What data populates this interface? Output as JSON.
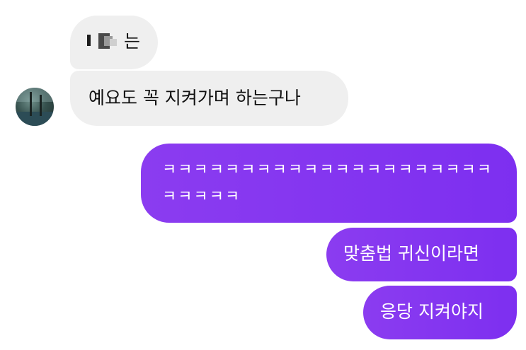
{
  "messages": {
    "incoming": [
      {
        "text": "는"
      },
      {
        "text": "예요도 꼭 지켜가며 하는구나"
      }
    ],
    "outgoing": [
      {
        "text": "ㅋㅋㅋㅋㅋㅋㅋㅋㅋㅋㅋㅋㅋㅋㅋㅋㅋㅋㅋㅋㅋㅋㅋㅋㅋㅋ"
      },
      {
        "text": "맞춤법 귀신이라면"
      },
      {
        "text": "응당 지켜야지"
      }
    ]
  },
  "avatar": {
    "icon": "profile-photo-icon"
  },
  "colors": {
    "incoming_bubble": "#efefef",
    "outgoing_bubble": "#8b3cf0",
    "background": "#ffffff"
  }
}
